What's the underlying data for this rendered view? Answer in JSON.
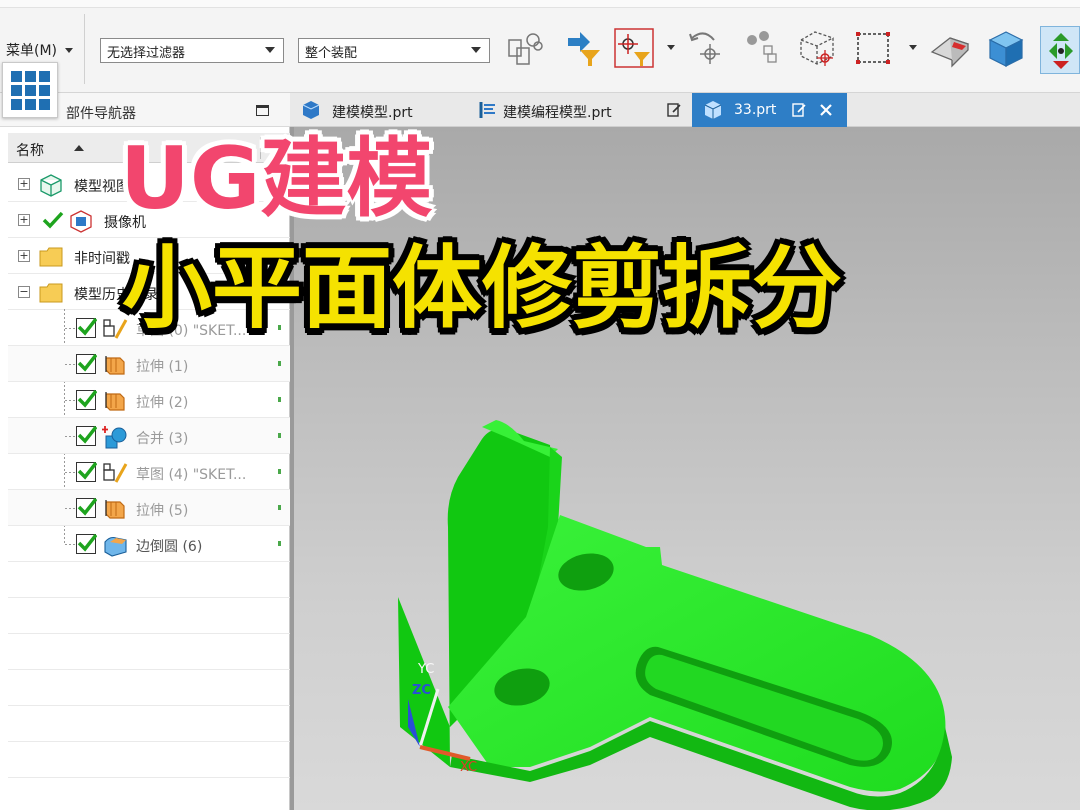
{
  "toolbar": {
    "menu_label": "菜单(M)",
    "filter_select": "无选择过滤器",
    "assembly_select": "整个装配",
    "icons": [
      "assembly-icon",
      "filter-arrow-icon",
      "point-filter-icon",
      "rotate-point-icon",
      "binoculars-icon",
      "box-point-icon",
      "dashed-rect-icon",
      "erase-icon",
      "cube-icon",
      "snap-icon"
    ]
  },
  "navigator": {
    "title": "部件导航器",
    "column_name": "名称",
    "column_extra": "最",
    "items": [
      {
        "label": "模型视图",
        "icon": "model-views-icon",
        "expander": "+"
      },
      {
        "label": "摄像机",
        "icon": "camera-icon",
        "expander": "+"
      },
      {
        "label": "非时间戳",
        "icon": "folder-icon",
        "expander": "+"
      },
      {
        "label": "模型历史记录",
        "icon": "folder-icon",
        "expander": "−"
      }
    ],
    "history": [
      {
        "label": "草图 (0) \"SKET...",
        "icon": "sketch-icon"
      },
      {
        "label": "拉伸 (1)",
        "icon": "extrude-icon"
      },
      {
        "label": "拉伸 (2)",
        "icon": "extrude-icon"
      },
      {
        "label": "合并 (3)",
        "icon": "unite-icon"
      },
      {
        "label": "草图 (4) \"SKET...",
        "icon": "sketch-icon"
      },
      {
        "label": "拉伸 (5)",
        "icon": "extrude-icon"
      },
      {
        "label": "边倒圆 (6)",
        "icon": "edge-blend-icon"
      }
    ]
  },
  "tabs": [
    {
      "label": "建模模型.prt"
    },
    {
      "label": "建模编程模型.prt"
    },
    {
      "label": "33.prt",
      "active": true
    }
  ],
  "viewport": {
    "axis_y": "YC",
    "axis_z": "ZC",
    "axis_x": "XC",
    "model_color": "#22e522"
  },
  "overlay": {
    "title_line1": "UG建模",
    "title_line2": "小平面体修剪拆分"
  }
}
